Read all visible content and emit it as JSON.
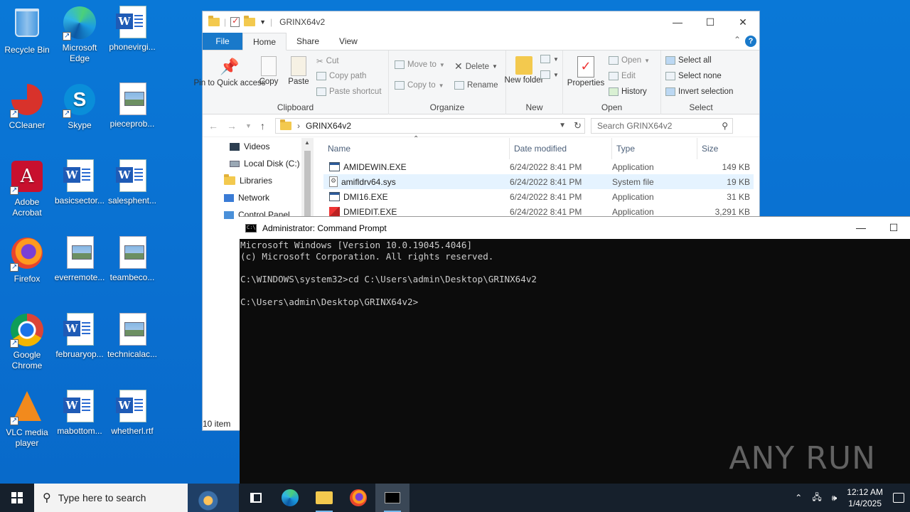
{
  "desktop": {
    "icons": [
      {
        "label": "Recycle Bin"
      },
      {
        "label": "Microsoft Edge"
      },
      {
        "label": "phonevirgi..."
      },
      {
        "label": "CCleaner"
      },
      {
        "label": "Skype"
      },
      {
        "label": "pieceprob..."
      },
      {
        "label": "Adobe Acrobat"
      },
      {
        "label": "basicsector..."
      },
      {
        "label": "salesphent..."
      },
      {
        "label": "Firefox"
      },
      {
        "label": "everremote..."
      },
      {
        "label": "teambeco..."
      },
      {
        "label": "Google Chrome"
      },
      {
        "label": "februaryop..."
      },
      {
        "label": "technicalac..."
      },
      {
        "label": "VLC media player"
      },
      {
        "label": "mabottom..."
      },
      {
        "label": "whetherl.rtf"
      }
    ]
  },
  "explorer": {
    "title": "GRINX64v2",
    "tabs": {
      "file": "File",
      "home": "Home",
      "share": "Share",
      "view": "View"
    },
    "ribbon": {
      "pin": "Pin to Quick access",
      "copy": "Copy",
      "paste": "Paste",
      "cut": "Cut",
      "copy_path": "Copy path",
      "paste_shortcut": "Paste shortcut",
      "clipboard": "Clipboard",
      "move_to": "Move to",
      "copy_to": "Copy to",
      "delete": "Delete",
      "rename": "Rename",
      "organize": "Organize",
      "new_folder": "New folder",
      "new": "New",
      "properties": "Properties",
      "open": "Open",
      "edit": "Edit",
      "history": "History",
      "open_group": "Open",
      "select_all": "Select all",
      "select_none": "Select none",
      "invert_selection": "Invert selection",
      "select": "Select"
    },
    "address": "GRINX64v2",
    "search_placeholder": "Search GRINX64v2",
    "nav": {
      "videos": "Videos",
      "local_disk": "Local Disk (C:)",
      "libraries": "Libraries",
      "network": "Network",
      "control_panel": "Control Panel"
    },
    "columns": {
      "name": "Name",
      "date": "Date modified",
      "type": "Type",
      "size": "Size"
    },
    "files": [
      {
        "name": "AMIDEWIN.EXE",
        "date": "6/24/2022 8:41 PM",
        "type": "Application",
        "size": "149 KB"
      },
      {
        "name": "amifldrv64.sys",
        "date": "6/24/2022 8:41 PM",
        "type": "System file",
        "size": "19 KB"
      },
      {
        "name": "DMI16.EXE",
        "date": "6/24/2022 8:41 PM",
        "type": "Application",
        "size": "31 KB"
      },
      {
        "name": "DMIEDIT.EXE",
        "date": "6/24/2022 8:41 PM",
        "type": "Application",
        "size": "3,291 KB"
      }
    ],
    "status": "10 item"
  },
  "cmd": {
    "title": "Administrator: Command Prompt",
    "lines": [
      "Microsoft Windows [Version 10.0.19045.4046]",
      "(c) Microsoft Corporation. All rights reserved.",
      "",
      "C:\\WINDOWS\\system32>cd C:\\Users\\admin\\Desktop\\GRINX64v2",
      "",
      "C:\\Users\\admin\\Desktop\\GRINX64v2>"
    ],
    "watermark": "ANY RUN"
  },
  "taskbar": {
    "search_placeholder": "Type here to search",
    "time": "12:12 AM",
    "date": "1/4/2025"
  }
}
